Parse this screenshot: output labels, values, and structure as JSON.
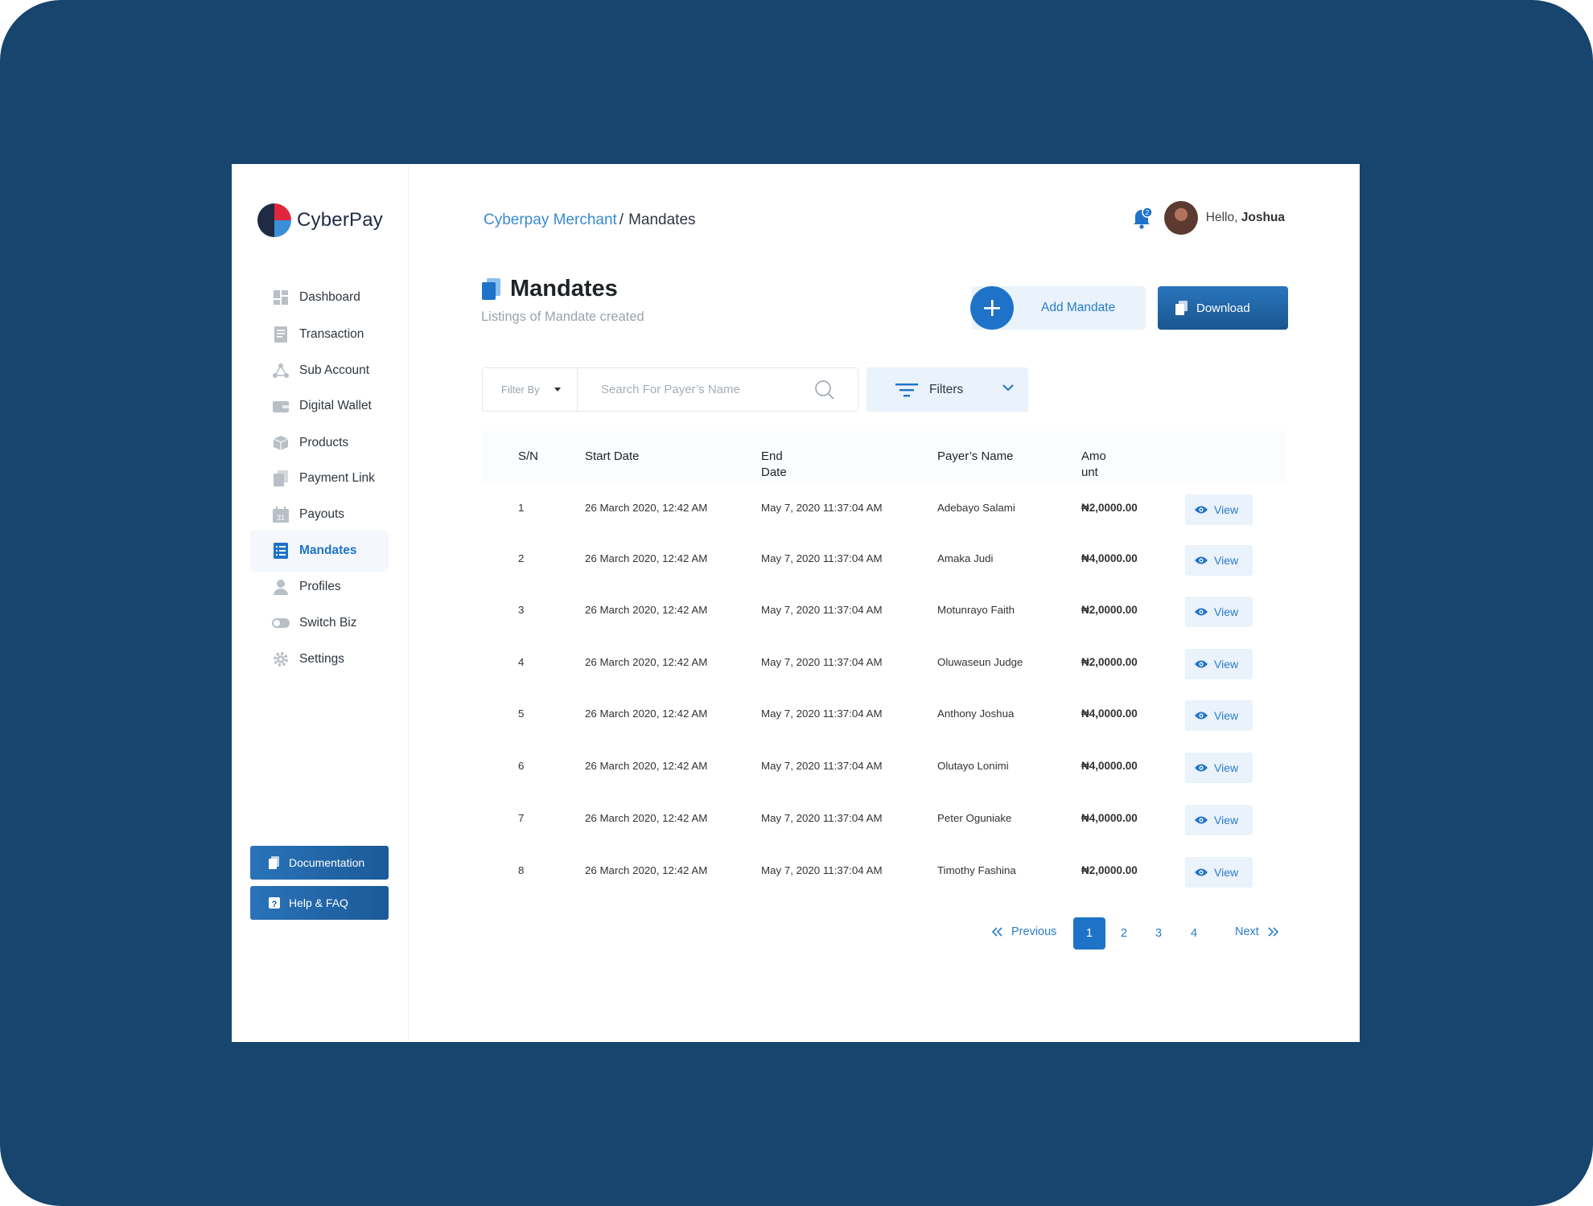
{
  "app": {
    "brand": "CyberPay",
    "accent": "#1e73c8",
    "background": "#17456e"
  },
  "sidebar": {
    "items": [
      {
        "label": "Dashboard",
        "icon": "dashboard-icon",
        "active": false
      },
      {
        "label": "Transaction",
        "icon": "receipt-icon",
        "active": false
      },
      {
        "label": "Sub Account",
        "icon": "network-icon",
        "active": false
      },
      {
        "label": "Digital Wallet",
        "icon": "wallet-icon",
        "active": false
      },
      {
        "label": "Products",
        "icon": "box-icon",
        "active": false
      },
      {
        "label": "Payment Link",
        "icon": "documents-icon",
        "active": false
      },
      {
        "label": "Payouts",
        "icon": "calendar-icon",
        "active": false
      },
      {
        "label": "Mandates",
        "icon": "list-document-icon",
        "active": true
      },
      {
        "label": "Profiles",
        "icon": "user-icon",
        "active": false
      },
      {
        "label": "Switch Biz",
        "icon": "toggle-icon",
        "active": false
      },
      {
        "label": "Settings",
        "icon": "gear-icon",
        "active": false
      }
    ],
    "documentation_label": "Documentation",
    "help_label": "Help & FAQ"
  },
  "header": {
    "breadcrumb_root": "Cyberpay Merchant",
    "breadcrumb_sep": "/",
    "breadcrumb_current": "Mandates",
    "notification_count": "2",
    "greeting": "Hello,",
    "user_name": "Joshua"
  },
  "page": {
    "title": "Mandates",
    "subtitle": "Listings of Mandate created",
    "add_label": "Add Mandate",
    "download_label": "Download"
  },
  "search": {
    "filter_by": "Filter By",
    "placeholder": "Search For Payer’s Name",
    "value": "",
    "filters_label": "Filters"
  },
  "table": {
    "headers": {
      "sn": "S/N",
      "start": "Start Date",
      "end_1": "End",
      "end_2": "Date",
      "payer": "Payer’s Name",
      "amount_1": "Amo",
      "amount_2": "unt"
    },
    "view_label": "View",
    "rows": [
      {
        "sn": "1",
        "start": "26 March 2020, 12:42 AM",
        "end": "May 7, 2020 11:37:04 AM",
        "payer": "Adebayo Salami",
        "amount": "₦2,0000.00"
      },
      {
        "sn": "2",
        "start": "26 March 2020, 12:42 AM",
        "end": "May 7, 2020 11:37:04 AM",
        "payer": "Amaka Judi",
        "amount": "₦4,0000.00"
      },
      {
        "sn": "3",
        "start": "26 March 2020, 12:42 AM",
        "end": "May 7, 2020 11:37:04 AM",
        "payer": "Motunrayo Faith",
        "amount": "₦2,0000.00"
      },
      {
        "sn": "4",
        "start": "26 March 2020, 12:42 AM",
        "end": "May 7, 2020 11:37:04 AM",
        "payer": "Oluwaseun Judge",
        "amount": "₦2,0000.00"
      },
      {
        "sn": "5",
        "start": "26 March 2020, 12:42 AM",
        "end": "May 7, 2020 11:37:04 AM",
        "payer": "Anthony Joshua",
        "amount": "₦4,0000.00"
      },
      {
        "sn": "6",
        "start": "26 March 2020, 12:42 AM",
        "end": "May 7, 2020 11:37:04 AM",
        "payer": "Olutayo Lonimi",
        "amount": "₦4,0000.00"
      },
      {
        "sn": "7",
        "start": "26 March 2020, 12:42 AM",
        "end": "May 7, 2020 11:37:04 AM",
        "payer": "Peter Oguniake",
        "amount": "₦4,0000.00"
      },
      {
        "sn": "8",
        "start": "26 March 2020, 12:42 AM",
        "end": "May 7, 2020 11:37:04 AM",
        "payer": "Timothy  Fashina",
        "amount": "₦2,0000.00"
      }
    ]
  },
  "pagination": {
    "previous_label": "Previous",
    "next_label": "Next",
    "pages": [
      "1",
      "2",
      "3",
      "4"
    ],
    "current": "1"
  }
}
